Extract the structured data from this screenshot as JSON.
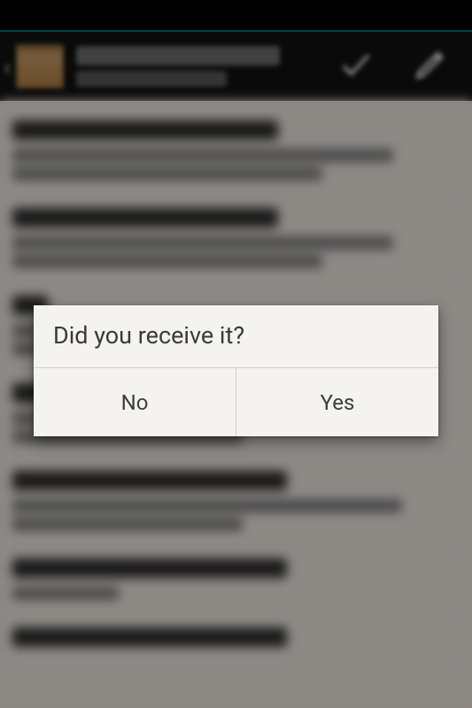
{
  "dialog": {
    "title": "Did you receive it?",
    "no_label": "No",
    "yes_label": "Yes"
  },
  "actionbar": {
    "checkmark_icon": "checkmark-icon",
    "edit_icon": "pencil-icon",
    "box_icon": "package-box-icon"
  }
}
